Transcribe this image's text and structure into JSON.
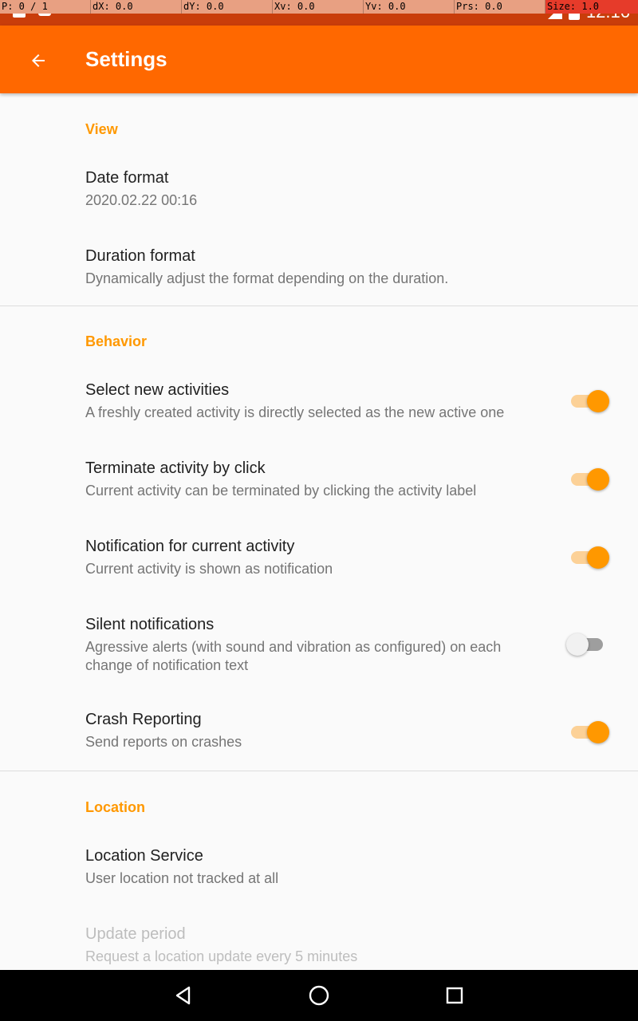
{
  "status_bar": {
    "debug": [
      "P: 0 / 1",
      "dX: 0.0",
      "dY: 0.0",
      "Xv: 0.0",
      "Yv: 0.0",
      "Prs: 0.0",
      "Size: 1.0"
    ],
    "time": "12:16",
    "icons": [
      "notification-square-icon",
      "android-icon",
      "signal-icon",
      "battery-icon"
    ]
  },
  "toolbar": {
    "back_icon": "arrow-back-icon",
    "title": "Settings",
    "color": "#ff6800"
  },
  "sections": {
    "view": {
      "title": "View",
      "date_format": {
        "title": "Date format",
        "summary": "2020.02.22 00:16"
      },
      "duration_format": {
        "title": "Duration format",
        "summary": "Dynamically adjust the format depending on the duration."
      }
    },
    "behavior": {
      "title": "Behavior",
      "select_new": {
        "title": "Select new activities",
        "summary": "A freshly created activity is directly selected as the new active one",
        "enabled": true
      },
      "terminate_click": {
        "title": "Terminate activity by click",
        "summary": "Current activity can be terminated by clicking the activity label",
        "enabled": true
      },
      "notification": {
        "title": "Notification for current activity",
        "summary": "Current activity is shown as notification",
        "enabled": true
      },
      "silent": {
        "title": "Silent notifications",
        "summary": "Agressive alerts (with sound and vibration as configured) on each change of notification text",
        "enabled": false
      },
      "crash": {
        "title": "Crash Reporting",
        "summary": "Send reports on crashes",
        "enabled": true
      }
    },
    "location": {
      "title": "Location",
      "service": {
        "title": "Location Service",
        "summary": "User location not tracked at all"
      },
      "update_period": {
        "title": "Update period",
        "summary": "Request a location update every 5 minutes",
        "disabled": true
      }
    }
  },
  "accent_color": "#ff9800",
  "nav_bar": {
    "icons": [
      "back-triangle-icon",
      "home-circle-icon",
      "recents-square-icon"
    ]
  }
}
